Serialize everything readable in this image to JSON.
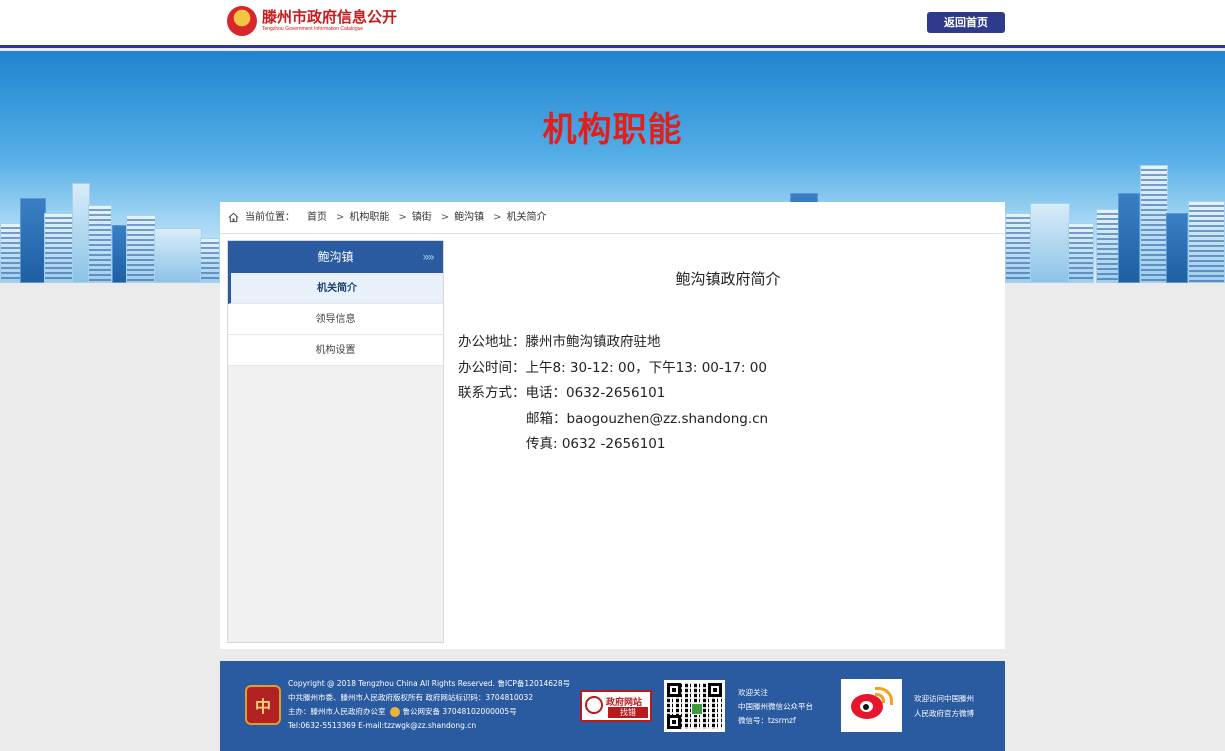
{
  "header": {
    "logo_title": "滕州市政府信息公开",
    "logo_subtitle": "Tengzhou Government Information Catalogue",
    "home_button": "返回首页"
  },
  "banner": {
    "title": "机构职能"
  },
  "breadcrumb": {
    "label": "当前位置：",
    "items": [
      "首页",
      "机构职能",
      "镇街",
      "鲍沟镇",
      "机关简介"
    ],
    "separator": ">"
  },
  "sidebar": {
    "header": "鲍沟镇",
    "arrows": "»»",
    "items": [
      {
        "label": "机关简介",
        "active": true
      },
      {
        "label": "领导信息",
        "active": false
      },
      {
        "label": "机构设置",
        "active": false
      }
    ]
  },
  "main": {
    "title": "鲍沟镇政府简介",
    "rows": [
      {
        "label": "办公地址：",
        "value": "滕州市鲍沟镇政府驻地"
      },
      {
        "label": "办公时间：",
        "value": "上午8: 30-12: 00，下午13: 00-17: 00"
      },
      {
        "label": "联系方式：",
        "value": "电话：0632-2656101"
      },
      {
        "label": "",
        "value": "邮箱：baogouzhen@zz.shandong.cn"
      },
      {
        "label": "",
        "value": "传真: 0632 -2656101"
      }
    ]
  },
  "footer": {
    "lines": [
      "Copyright @ 2018 Tengzhou China All Rights Reserved. 鲁ICP备12014628号",
      "中共滕州市委、滕州市人民政府版权所有 政府网站标识码：3704810032",
      "主办：滕州市人民政府办公室",
      "鲁公网安备 37048102000005号",
      "Tel:0632-5513369 E-mail:tzzwgk@zz.shandong.cn"
    ],
    "emblem_text": "党政机关",
    "gov_badge_line1": "政府网站",
    "gov_badge_line2": "找错",
    "wechat_lines": [
      "欢迎关注",
      "中国滕州微信公众平台",
      "微信号：tzsrmzf"
    ],
    "weibo_lines": [
      "欢迎访问中国滕州",
      "人民政府官方微博"
    ]
  },
  "colors": {
    "brand_navy": "#2e3a8c",
    "sidebar_blue": "#2a5aa0",
    "banner_title_red": "#e0201c",
    "logo_red": "#c81c1c"
  }
}
